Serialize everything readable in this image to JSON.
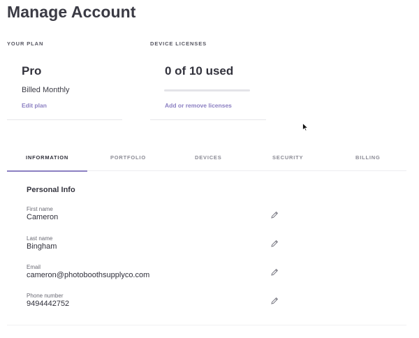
{
  "page": {
    "title": "Manage Account"
  },
  "plan": {
    "section_label": "YOUR PLAN",
    "name": "Pro",
    "billing": "Billed Monthly",
    "edit_link": "Edit plan"
  },
  "licenses": {
    "section_label": "DEVICE LICENSES",
    "usage": "0 of 10 used",
    "used": 0,
    "total": 10,
    "link": "Add or remove licenses"
  },
  "tabs": [
    {
      "label": "INFORMATION",
      "active": true
    },
    {
      "label": "PORTFOLIO",
      "active": false
    },
    {
      "label": "DEVICES",
      "active": false
    },
    {
      "label": "SECURITY",
      "active": false
    },
    {
      "label": "BILLING",
      "active": false
    }
  ],
  "personal_info": {
    "title": "Personal Info",
    "fields": [
      {
        "label": "First name",
        "value": "Cameron"
      },
      {
        "label": "Last name",
        "value": "Bingham"
      },
      {
        "label": "Email",
        "value": "cameron@photoboothsupplyco.com"
      },
      {
        "label": "Phone number",
        "value": "9494442752"
      }
    ]
  },
  "colors": {
    "accent": "#8b7fc2",
    "text": "#2f2f3a",
    "muted": "#8a8a94"
  },
  "icons": {
    "edit": "pencil-icon",
    "cursor": "mouse-pointer"
  }
}
